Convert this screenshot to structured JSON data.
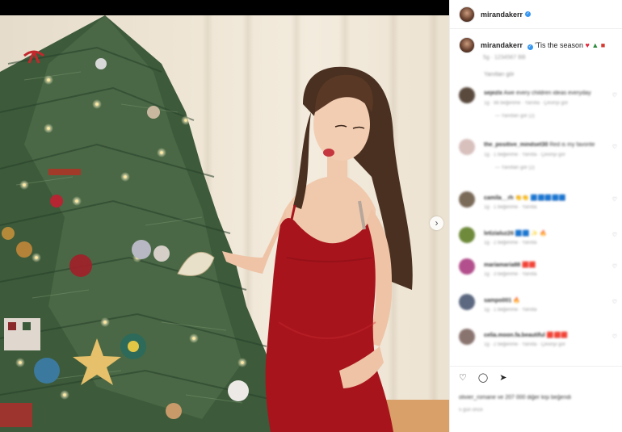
{
  "post": {
    "username": "mirandakerr",
    "caption_text": "'Tis the season",
    "caption_emojis": [
      "♥",
      "▲",
      "■"
    ],
    "timestamp": "5g · 1234567 BB",
    "view_more": "Yanıtları gör"
  },
  "comments": [
    {
      "user": "sejezlx",
      "text": "Awe every children ideas everyday",
      "meta": "1g · 98 beğenme · Yanıtla · Çeviriyi gör",
      "reply": "— Yanıtları gör (2)",
      "color": "#5a4a3e"
    },
    {
      "user": "the_positive_mindset30",
      "text": "Red is my favorite",
      "meta": "1g · 1 beğenme · Yanıtla · Çeviriyi gör",
      "reply": "— Yanıtları gör (2)",
      "color": "#d8c0bd"
    },
    {
      "user": "camila__rh",
      "text": "👏👏 🟦🟦🟦🟦🟦",
      "meta": "1g · 1 beğenme · Yanıtla",
      "reply": "",
      "color": "#7a6a58"
    },
    {
      "user": "letizialuz26",
      "text": "🟦🟦 ✨ 🔥",
      "meta": "1g · 2 beğenme · Yanıtla",
      "reply": "",
      "color": "#6e8a3a"
    },
    {
      "user": "mariamaria88",
      "text": "🟥🟥",
      "meta": "1g · 3 beğenme · Yanıtla",
      "reply": "",
      "color": "#b24f8c"
    },
    {
      "user": "sampo001",
      "text": "🔥",
      "meta": "1g · 1 beğenme · Yanıtla",
      "reply": "",
      "color": "#5c6880"
    },
    {
      "user": "celia.moon.fa.beautiful",
      "text": "🟥🟥🟥",
      "meta": "1g · 2 beğenme · Yanıtla · Çeviriyi gör",
      "reply": "",
      "color": "#8a7470"
    }
  ],
  "actions": {
    "like_icon": "heart-icon",
    "comment_icon": "comment-icon",
    "share_icon": "share-icon"
  },
  "likes_text": "olivier_romane ve 207 000 diğer kişi beğendi",
  "time_ago": "5 gün önce"
}
